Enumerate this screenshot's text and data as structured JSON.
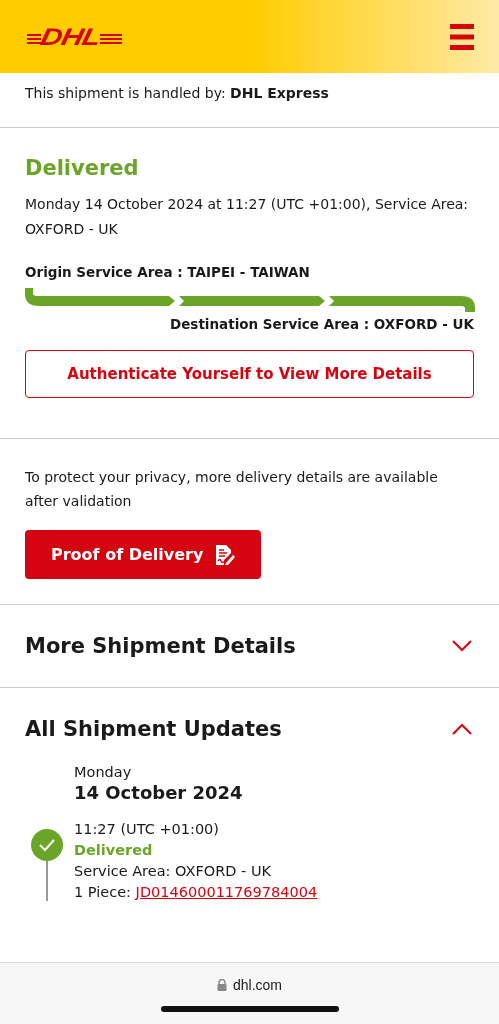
{
  "header": {
    "logo": "DHL"
  },
  "handled_by": "This shipment is handled by: **DHL Express**",
  "status": {
    "title": "Delivered",
    "detail": "Monday 14 October 2024 at 11:27 (UTC +01:00), Service Area: OXFORD - UK",
    "origin": "Origin Service Area : TAIPEI - TAIWAN",
    "destination": "Destination Service Area : OXFORD - UK",
    "auth_button": "Authenticate Yourself to View More Details"
  },
  "privacy": {
    "text": "To protect your privacy, more delivery details are available after validation",
    "button": "Proof of Delivery"
  },
  "sections": [
    {
      "title": "More Shipment Details",
      "expanded": false
    },
    {
      "title": "All Shipment Updates",
      "expanded": true
    }
  ],
  "updates": [
    {
      "day": "Monday",
      "date": "14 October 2024",
      "events": [
        {
          "kind": "delivered",
          "time": "11:27 (UTC +01:00)",
          "status": "Delivered",
          "area": "Service Area: OXFORD - UK",
          "piece_label": "1 Piece:",
          "piece_id": "JD014600011769784004"
        }
      ]
    }
  ],
  "browser": {
    "url": "dhl.com"
  }
}
